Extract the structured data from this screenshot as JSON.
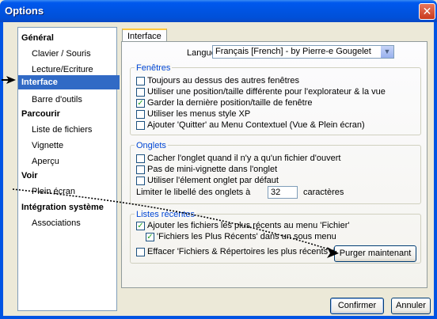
{
  "window": {
    "title": "Options",
    "close_glyph": "✕"
  },
  "sidebar": {
    "items": [
      {
        "label": "Général",
        "type": "cat"
      },
      {
        "label": "Clavier / Souris",
        "type": "sub"
      },
      {
        "label": "Lecture/Ecriture",
        "type": "sub"
      },
      {
        "label": "Interface",
        "type": "cat",
        "selected": true
      },
      {
        "label": "Barre d'outils",
        "type": "sub"
      },
      {
        "label": "Parcourir",
        "type": "cat"
      },
      {
        "label": "Liste de fichiers",
        "type": "sub"
      },
      {
        "label": "Vignette",
        "type": "sub"
      },
      {
        "label": "Aperçu",
        "type": "sub"
      },
      {
        "label": "Voir",
        "type": "cat"
      },
      {
        "label": "Plein écran",
        "type": "sub"
      },
      {
        "label": "Intégration système",
        "type": "cat"
      },
      {
        "label": "Associations",
        "type": "sub"
      }
    ]
  },
  "tab": {
    "label": "Interface"
  },
  "language": {
    "label": "Langue",
    "value": "Français [French] - by Pierre-e Gougelet",
    "arrow_glyph": "▼"
  },
  "groups": {
    "fenetres": {
      "title": "Fenêtres",
      "options": [
        {
          "label": "Toujours au dessus des autres fenêtres",
          "checked": false
        },
        {
          "label": "Utiliser une position/taille différente pour l'explorateur & la vue",
          "checked": false
        },
        {
          "label": "Garder la dernière position/taille de fenêtre",
          "checked": true
        },
        {
          "label": "Utiliser les menus style XP",
          "checked": false
        },
        {
          "label": "Ajouter 'Quitter' au Menu Contextuel (Vue & Plein écran)",
          "checked": false
        }
      ]
    },
    "onglets": {
      "title": "Onglets",
      "options": [
        {
          "label": "Cacher l'onglet quand il n'y a qu'un fichier d'ouvert",
          "checked": false
        },
        {
          "label": "Pas de mini-vignette dans l'onglet",
          "checked": false
        },
        {
          "label": "Utiliser l'élement onglet par défaut",
          "checked": false
        }
      ],
      "limit_label": "Limiter le libellé des onglets à",
      "limit_value": "32",
      "limit_unit": "caractères"
    },
    "recentes": {
      "title": "Listes récentes",
      "options": [
        {
          "label": "Ajouter les fichiers les plus récents au menu 'Fichier'",
          "checked": true
        },
        {
          "label": "'Fichiers les Plus Récents' dans un sous menu",
          "checked": true
        },
        {
          "label": "Effacer 'Fichiers & Répertoires les plus récents' à la sortie",
          "checked": false
        }
      ],
      "purge_label": "Purger maintenant"
    }
  },
  "footer": {
    "confirm_label": "Confirmer",
    "cancel_label": "Annuler"
  },
  "check_glyph": "✓",
  "colors": {
    "title_bar": "#0054E3",
    "selection": "#316AC5",
    "group_title": "#0046D5",
    "check": "#21A121"
  }
}
